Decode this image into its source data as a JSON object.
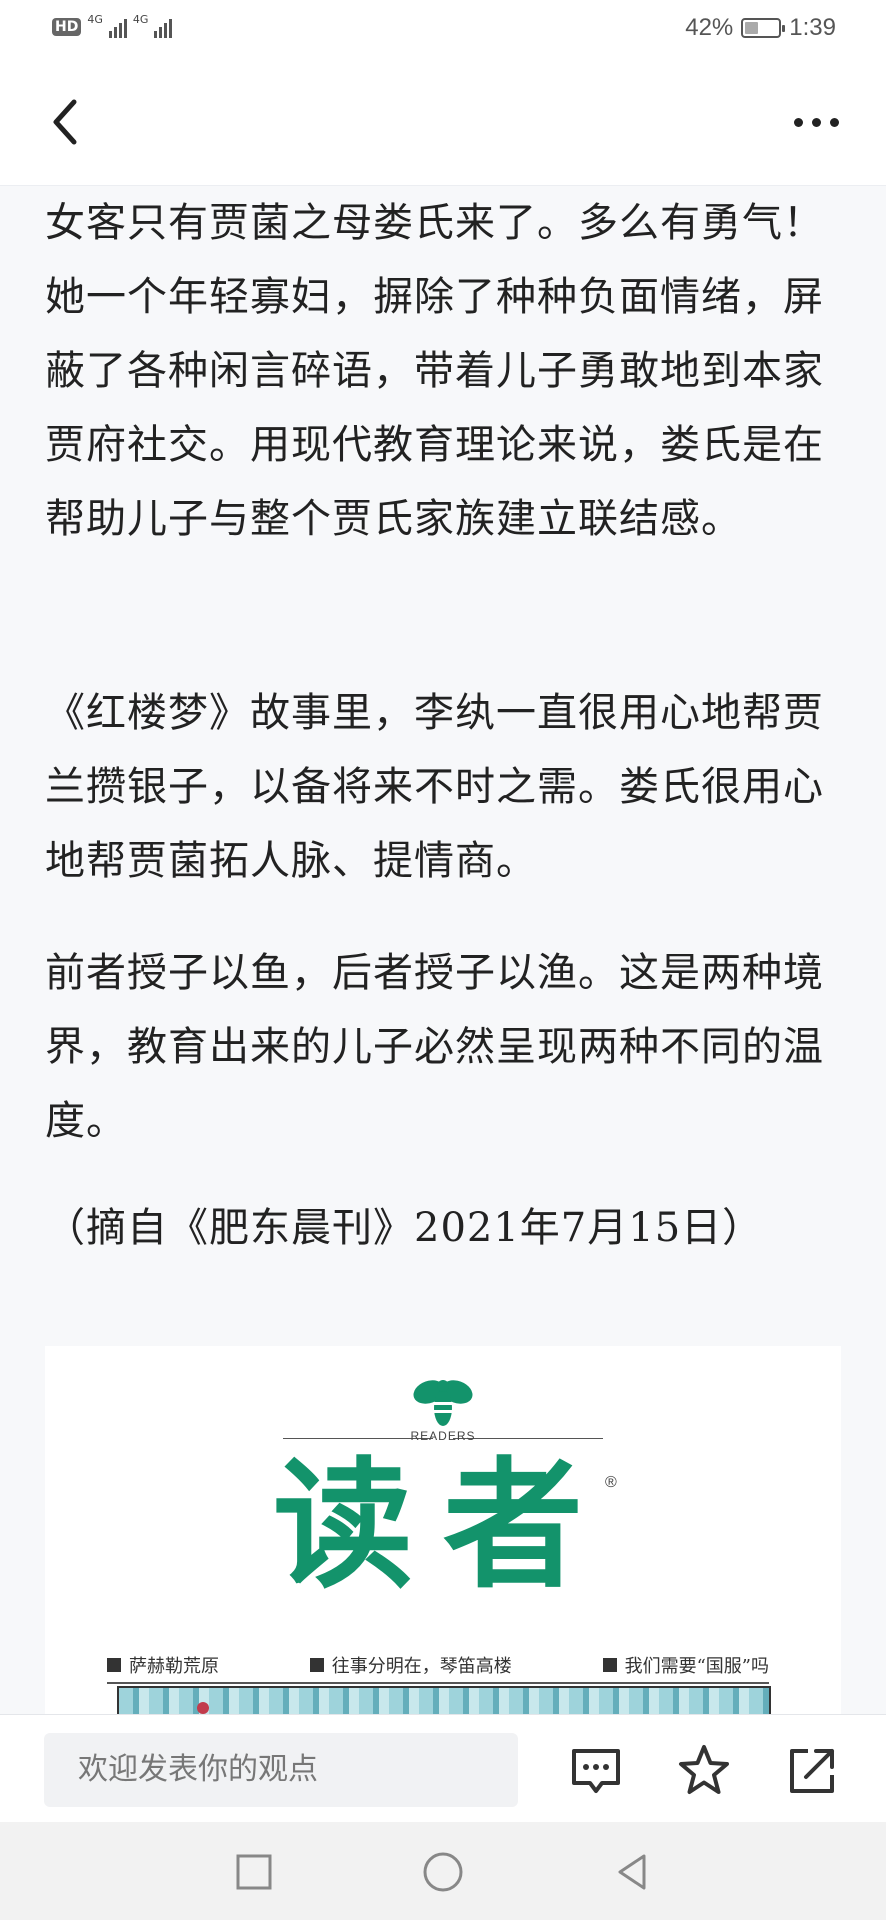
{
  "status_bar": {
    "hd_label": "HD",
    "network_1": "4G",
    "network_2": "4G",
    "battery_percent": "42%",
    "battery_level": 0.42,
    "time": "1:39"
  },
  "header": {
    "back_icon": "chevron-left-icon",
    "more_icon": "more-horizontal-icon"
  },
  "article": {
    "paragraphs": [
      "女客只有贾菌之母娄氏来了。多么有勇气！她一个年轻寡妇，摒除了种种负面情绪，屏蔽了各种闲言碎语，带着儿子勇敢地到本家贾府社交。用现代教育理论来说，娄氏是在帮助儿子与整个贾氏家族建立联结感。",
      "《红楼梦》故事里，李纨一直很用心地帮贾兰攒银子，以备将来不时之需。娄氏很用心地帮贾菌拓人脉、提情商。",
      "前者授子以鱼，后者授子以渔。这是两种境界，教育出来的儿子必然呈现两种不同的温度。",
      "（摘自《肥东晨刊》2021年7月15日）"
    ]
  },
  "magazine_image": {
    "brand_en": "READERS",
    "brand_cn": "读者",
    "registered_mark": "®",
    "brand_color": "#13936b",
    "headlines": [
      "萨赫勒荒原",
      "往事分明在，琴笛高楼",
      "我们需要“国服”吗"
    ]
  },
  "comment_bar": {
    "placeholder": "欢迎发表你的观点",
    "icons": [
      "comment-icon",
      "star-icon",
      "share-icon"
    ]
  },
  "system_nav": {
    "icons": [
      "recents-square-icon",
      "home-circle-icon",
      "back-triangle-icon"
    ]
  }
}
